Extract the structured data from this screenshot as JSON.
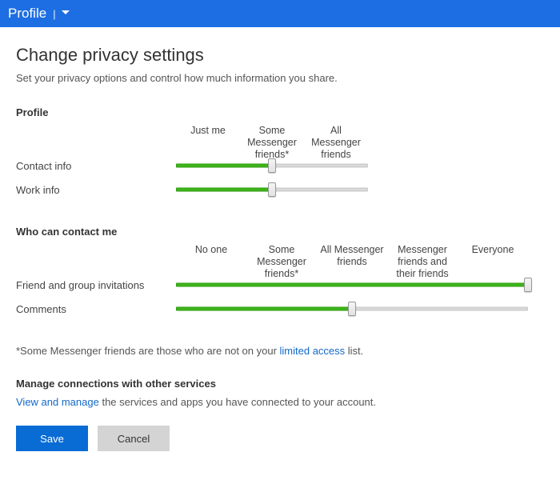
{
  "topbar": {
    "title": "Profile"
  },
  "page": {
    "heading": "Change privacy settings",
    "subtitle": "Set your privacy options and control how much information you share."
  },
  "profile_section": {
    "title": "Profile",
    "columns": [
      "Just me",
      "Some Messenger friends*",
      "All Messenger friends"
    ],
    "rows": [
      {
        "label": "Contact info",
        "value_index": 1,
        "max_index": 2
      },
      {
        "label": "Work info",
        "value_index": 1,
        "max_index": 2
      }
    ]
  },
  "contact_section": {
    "title": "Who can contact me",
    "columns": [
      "No one",
      "Some Messenger friends*",
      "All Messenger friends",
      "Messenger friends and their friends",
      "Everyone"
    ],
    "rows": [
      {
        "label": "Friend and group invitations",
        "value_index": 4,
        "max_index": 4
      },
      {
        "label": "Comments",
        "value_index": 2,
        "max_index": 4
      }
    ]
  },
  "footnote": {
    "prefix": "*Some Messenger friends are those who are not on your ",
    "link": "limited access",
    "suffix": " list."
  },
  "manage": {
    "title": "Manage connections with other services",
    "link": "View and manage",
    "rest": " the services and apps you have connected to your account."
  },
  "buttons": {
    "save": "Save",
    "cancel": "Cancel"
  }
}
